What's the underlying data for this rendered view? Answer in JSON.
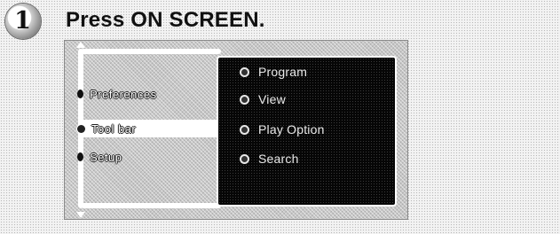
{
  "step": {
    "number": "1",
    "instruction": "Press ON SCREEN."
  },
  "menu": {
    "left_items": [
      {
        "label": "Preferences",
        "active": false
      },
      {
        "label": "Tool bar",
        "active": true
      },
      {
        "label": "Setup",
        "active": false
      }
    ],
    "sub_items": [
      {
        "label": "Program"
      },
      {
        "label": "View"
      },
      {
        "label": "Play Option"
      },
      {
        "label": "Search"
      }
    ]
  },
  "icons": {
    "step_badge": "circled-digit-icon",
    "scroll_up": "triangle-up-icon",
    "scroll_down": "triangle-down-icon",
    "active_arrow": "triangle-right-icon",
    "left_bullet": "dot-icon",
    "sub_bullet": "ring-icon"
  },
  "colors": {
    "submenu_background": "#060606",
    "highlight": "#ffffff"
  }
}
